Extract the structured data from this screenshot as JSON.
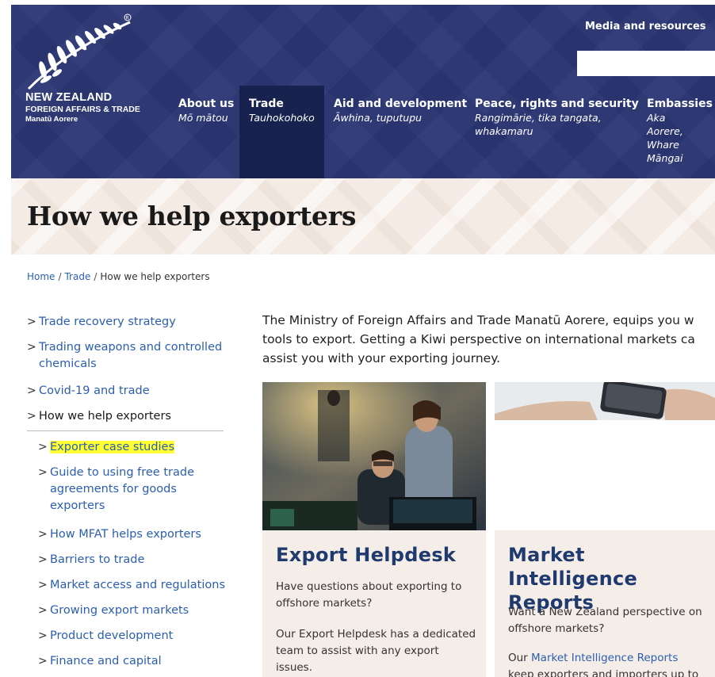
{
  "header": {
    "logo_title": "NEW ZEALAND",
    "logo_subtitle": "FOREIGN AFFAIRS & TRADE",
    "logo_maori": "Manatū Aorere",
    "media_link": "Media and resources",
    "search_value": "",
    "colors": {
      "primary": "#2b3674",
      "active_nav": "#17224f"
    }
  },
  "nav": [
    {
      "en": "About us",
      "mi": "Mō mātou"
    },
    {
      "en": "Trade",
      "mi": "Tauhokohoko"
    },
    {
      "en": "Aid and development",
      "mi": "Āwhina, tuputupu"
    },
    {
      "en": "Peace, rights and security",
      "mi": "Rangimārie, tika tangata, whakamaru"
    },
    {
      "en": "Embassies",
      "mi": "Aka Aorere, Whare Māngai"
    }
  ],
  "page_title": "How we help exporters",
  "breadcrumb": {
    "home": "Home",
    "trade": "Trade",
    "current": "How we help exporters",
    "sep": "/"
  },
  "sidebar": {
    "top": [
      "Trade recovery strategy",
      "Trading weapons and controlled chemicals",
      "Covid-19 and trade",
      "How we help exporters"
    ],
    "sub": [
      "Exporter case studies",
      "Guide to using free trade agreements for goods exporters",
      "How MFAT helps exporters",
      "Barriers to trade",
      "Market access and regulations",
      "Growing export markets",
      "Product development",
      "Finance and capital"
    ]
  },
  "intro": {
    "line1": "The Ministry of Foreign Affairs and Trade Manatū Aorere, equips you w",
    "line2": "tools to export. Getting a Kiwi perspective on international markets ca",
    "line3": "assist you with your exporting journey."
  },
  "cards": {
    "helpdesk": {
      "title": "Export Helpdesk",
      "p1": "Have questions about exporting to offshore markets?",
      "p2": "Our Export Helpdesk has a dedicated team to assist with any export issues."
    },
    "market": {
      "title1": "Market Intelligence",
      "title2": "Reports",
      "p1": "Want a New Zealand perspective on offshore markets?",
      "p2_prefix": "Our ",
      "p2_link": "Market Intelligence Reports",
      "p2_suffix": "keep exporters and importers up to"
    }
  }
}
